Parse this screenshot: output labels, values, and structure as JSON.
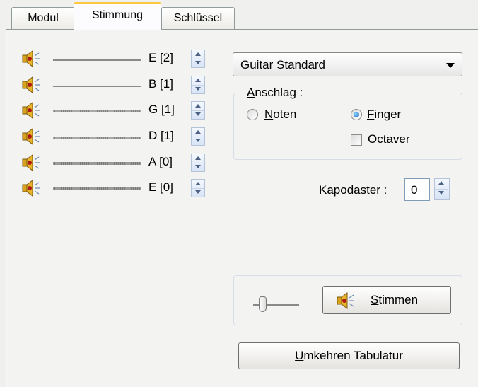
{
  "tabs": [
    {
      "label": "Modul"
    },
    {
      "label": "Stimmung",
      "active": true
    },
    {
      "label": "Schlüssel"
    }
  ],
  "strings": [
    {
      "label": "E [2]"
    },
    {
      "label": "B [1]"
    },
    {
      "label": "G [1]"
    },
    {
      "label": "D [1]"
    },
    {
      "label": "A [0]"
    },
    {
      "label": "E [0]"
    }
  ],
  "tuning": {
    "selected": "Guitar Standard"
  },
  "anschlag": {
    "title": "Anschlag :",
    "title_mnemonic": "A",
    "title_rest": "nschlag :",
    "noten_mnemonic": "N",
    "noten_rest": "oten",
    "finger_mnemonic": "F",
    "finger_rest": "inger",
    "selected": "Finger",
    "octaver_label": "Octaver",
    "octaver_checked": false
  },
  "kapodaster": {
    "label_mnemonic": "K",
    "label_rest": "apodaster :",
    "value": "0"
  },
  "stimmen_button": {
    "mnemonic": "S",
    "rest": "timmen"
  },
  "umkehren_button": {
    "mnemonic": "U",
    "rest": "mkehren Tabulatur"
  },
  "colors": {
    "tab_highlight": "#ffc83c",
    "radio_selected": "#1f6bc4",
    "spin_arrow": "#4d6185"
  }
}
